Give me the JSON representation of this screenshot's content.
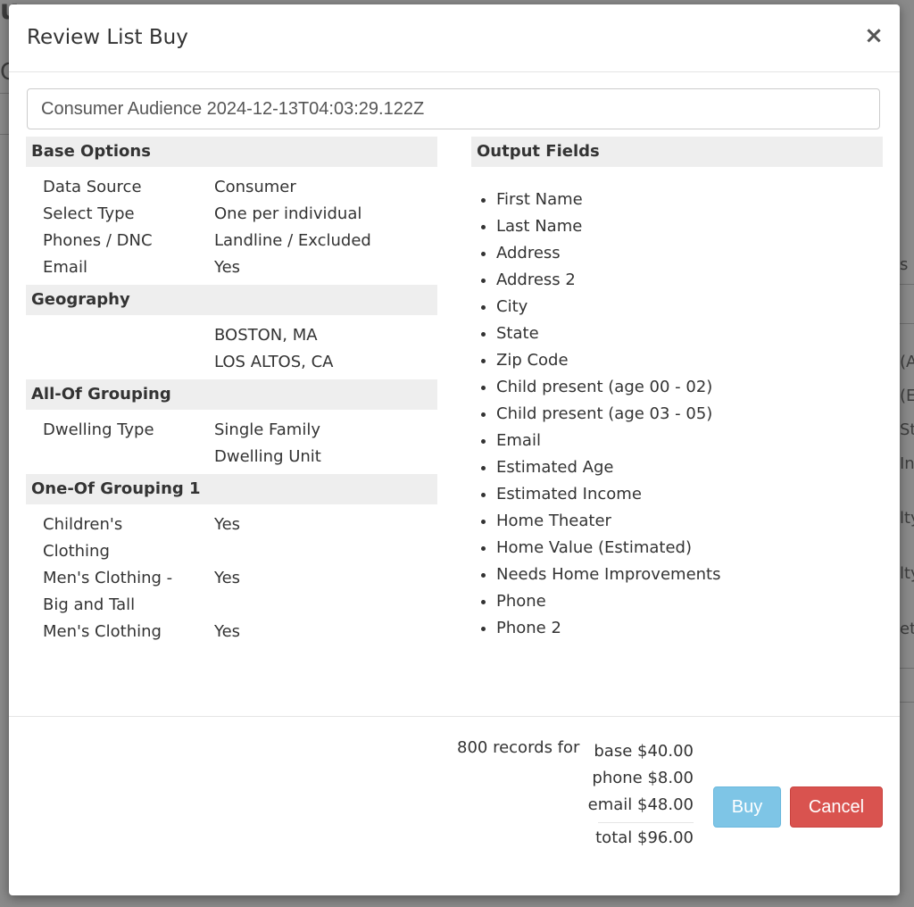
{
  "modal": {
    "title": "Review List Buy",
    "close_glyph": "×",
    "list_name": "Consumer Audience 2024-12-13T04:03:29.122Z"
  },
  "base_options": {
    "header": "Base Options",
    "rows": [
      {
        "key": "Data Source",
        "value": "Consumer"
      },
      {
        "key": "Select Type",
        "value": "One per individual"
      },
      {
        "key": "Phones / DNC",
        "value": "Landline / Excluded"
      },
      {
        "key": "Email",
        "value": "Yes"
      }
    ]
  },
  "geography": {
    "header": "Geography",
    "values": [
      "BOSTON, MA",
      "LOS ALTOS, CA"
    ]
  },
  "all_of": {
    "header": "All-Of Grouping",
    "rows": [
      {
        "key": "Dwelling Type",
        "value1": "Single Family",
        "value2": "Dwelling Unit"
      }
    ]
  },
  "one_of_1": {
    "header": "One-Of Grouping 1",
    "rows": [
      {
        "key1": "Children's",
        "key2": "Clothing",
        "value": "Yes"
      },
      {
        "key1": "Men's Clothing -",
        "key2": "Big and Tall",
        "value": "Yes"
      },
      {
        "key1": "Men's Clothing",
        "value": "Yes"
      }
    ]
  },
  "output_fields": {
    "header": "Output Fields",
    "items": [
      "First Name",
      "Last Name",
      "Address",
      "Address 2",
      "City",
      "State",
      "Zip Code",
      "Child present (age 00 - 02)",
      "Child present (age 03 - 05)",
      "Email",
      "Estimated Age",
      "Estimated Income",
      "Home Theater",
      "Home Value (Estimated)",
      "Needs Home Improvements",
      "Phone",
      "Phone 2"
    ]
  },
  "footer": {
    "records_text": "800 records for",
    "base": "base $40.00",
    "phone": "phone $8.00",
    "email": "email $48.00",
    "total": "total $96.00",
    "buy_label": "Buy",
    "cancel_label": "Cancel"
  },
  "background_fragments": {
    "f1": "u",
    "f2": "C",
    "f3": "s (",
    "f4": "(A",
    "f5": "(E",
    "f6": "St",
    "f7": "In",
    "f8": "lty",
    "f9": "lty",
    "f10": "et"
  },
  "colors": {
    "overlay": "#7f7f7f",
    "section_bg": "#eeeeee",
    "buy": "#7ec5e6",
    "cancel": "#d9534f"
  }
}
